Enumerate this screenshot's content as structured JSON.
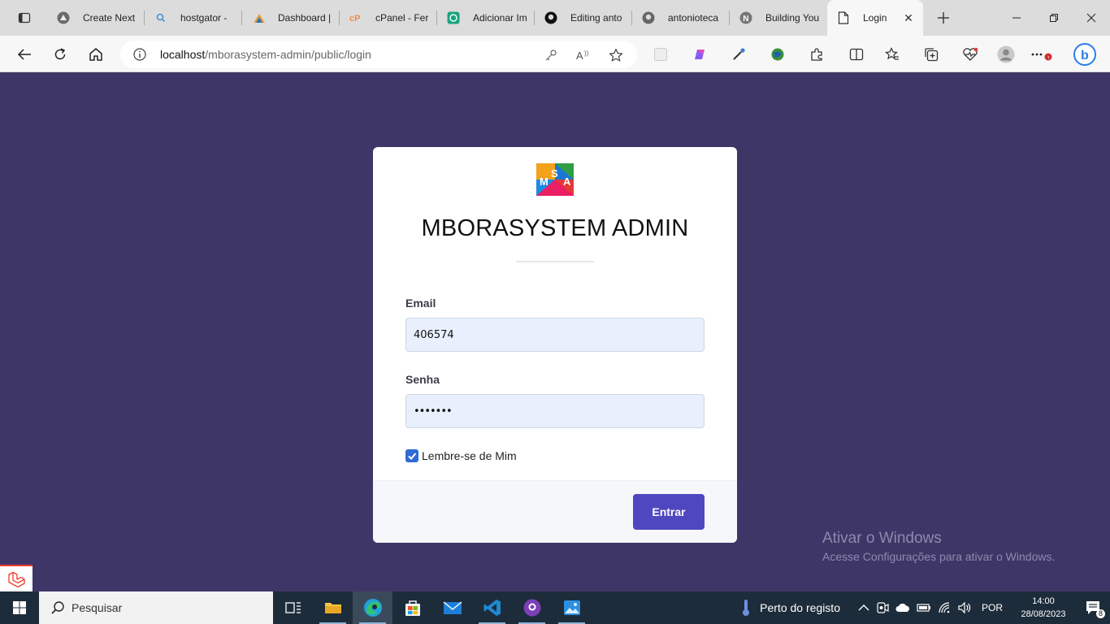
{
  "browser": {
    "tabs": [
      {
        "title": "Create Next",
        "icon": "vercel-icon"
      },
      {
        "title": "hostgator - ",
        "icon": "search-icon"
      },
      {
        "title": "Dashboard |",
        "icon": "dashboard-icon"
      },
      {
        "title": "cPanel - Fer",
        "icon": "cpanel-icon"
      },
      {
        "title": "Adicionar Im",
        "icon": "chatgpt-icon"
      },
      {
        "title": "Editing anto",
        "icon": "github-icon"
      },
      {
        "title": "antonioteca",
        "icon": "github-icon"
      },
      {
        "title": "Building You",
        "icon": "notion-icon"
      },
      {
        "title": "Login",
        "icon": "page-icon",
        "active": true
      }
    ],
    "url_host": "localhost",
    "url_path": "/mborasystem-admin/public/login"
  },
  "login": {
    "logo_letters": [
      "M",
      "S",
      "A"
    ],
    "title": "MBORASYSTEM ADMIN",
    "email_label": "Email",
    "email_value": "406574",
    "password_label": "Senha",
    "password_value": "•••••••",
    "remember_label": "Lembre-se de Mim",
    "remember_checked": true,
    "submit_label": "Entrar"
  },
  "watermark": {
    "line1": "Ativar o Windows",
    "line2": "Acesse Configurações para ativar o Windows."
  },
  "taskbar": {
    "search_placeholder": "Pesquisar",
    "weather_text": "Perto do registo",
    "language": "POR",
    "time": "14:00",
    "date": "28/08/2023",
    "notification_count": "8"
  },
  "colors": {
    "page_bg": "#3f3668",
    "button": "#4f47bf",
    "input_bg": "#e8f0fe",
    "checkbox": "#2f6bd6"
  }
}
